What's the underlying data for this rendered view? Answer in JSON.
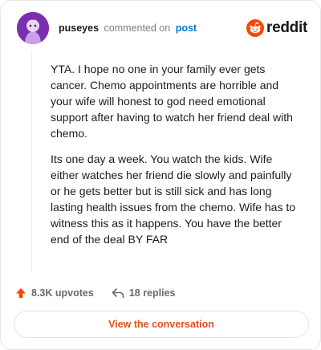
{
  "header": {
    "username": "puseyes",
    "action_text": "commented on",
    "post_link": "post",
    "brand_name": "reddit"
  },
  "comment": {
    "paragraphs": [
      "YTA. I hope no one in your family ever gets cancer. Chemo appointments are horrible and your wife will honest to god need emotional support after having to watch her friend deal with chemo.",
      "Its one day a week. You watch the kids. Wife either watches her friend die slowly and painfully or he gets better but is still sick and has long lasting health issues from the chemo. Wife has to witness this as it happens. You have the better end of the deal BY FAR"
    ]
  },
  "actions": {
    "upvotes": "8.3K upvotes",
    "replies": "18 replies"
  },
  "cta": {
    "label": "View the conversation"
  },
  "colors": {
    "brand_orange": "#ff4500",
    "link_blue": "#0079d3",
    "avatar_purple": "#7b2fb0",
    "cta_text": "#e0501e"
  },
  "icons": [
    "avatar-icon",
    "reddit-logo-icon",
    "upvote-icon",
    "reply-icon"
  ]
}
